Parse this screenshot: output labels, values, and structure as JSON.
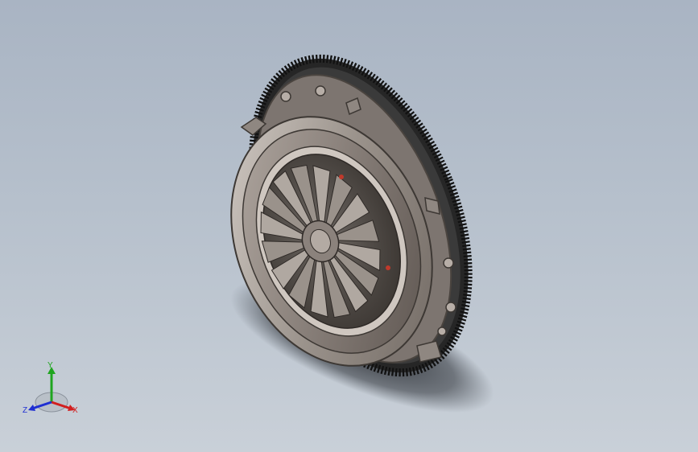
{
  "viewport": {
    "background_top": "#a9b4c3",
    "background_bottom": "#c9d0d8"
  },
  "model": {
    "ring_gear_color": "#2a2a2a",
    "cover_color": "#8b827c",
    "spring_color": "#a8a09a",
    "accent_color": "#c0392b"
  },
  "triad": {
    "x_label": "X",
    "y_label": "Y",
    "z_label": "Z",
    "x_color": "#d21f1f",
    "y_color": "#1fa51f",
    "z_color": "#1f2fd2"
  }
}
